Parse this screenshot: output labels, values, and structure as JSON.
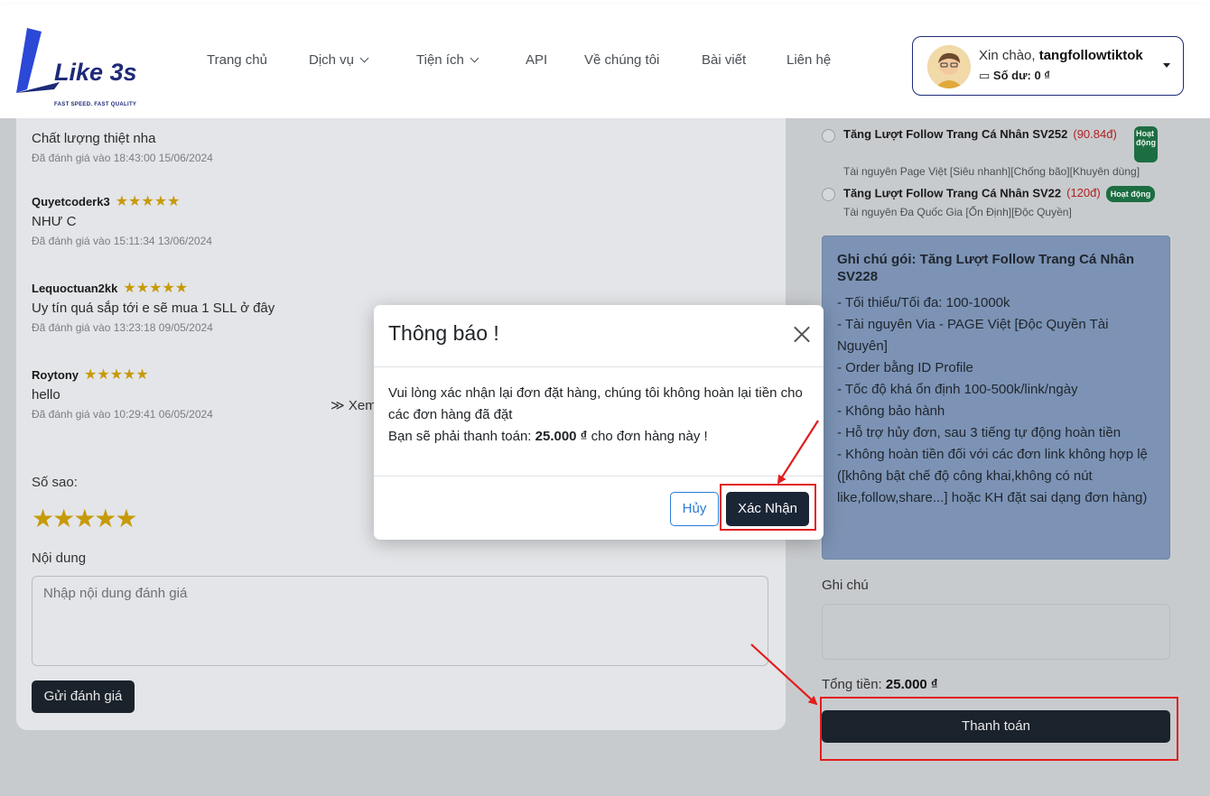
{
  "header": {
    "logo": {
      "brand": "Like 3s",
      "tagline": "FAST SPEED. FAST QUALITY"
    },
    "nav": [
      {
        "label": "Trang chủ"
      },
      {
        "label": "Dịch vụ"
      },
      {
        "label": "Tiện ích"
      },
      {
        "label": "API"
      },
      {
        "label": "Về chúng tôi"
      },
      {
        "label": "Bài viết"
      },
      {
        "label": "Liên hệ"
      }
    ],
    "user": {
      "greeting": "Xin chào,",
      "username": "tangfollowtiktok",
      "balance": "Số dư: 0 ₫"
    }
  },
  "reviews": [
    {
      "name": "",
      "text": "Chất lượng thiệt nha",
      "date": "Đã đánh giá vào 18:43:00 15/06/2024"
    },
    {
      "name": "Quyetcoderk3",
      "stars": "★★★★★",
      "text": "NHƯ C",
      "date": "Đã đánh giá vào 15:11:34 13/06/2024"
    },
    {
      "name": "Lequoctuan2kk",
      "stars": "★★★★★",
      "text": "Uy tín quá sắp tới e sẽ mua 1 SLL ở đây",
      "date": "Đã đánh giá vào 13:23:18 09/05/2024"
    },
    {
      "name": "Roytony",
      "stars": "★★★★★",
      "text": "hello",
      "date": "Đã đánh giá vào 10:29:41 06/05/2024"
    }
  ],
  "review_form": {
    "more": "Xem",
    "stars_label": "Số sao:",
    "stars": "★★★★★",
    "content_label": "Nội dung",
    "content_placeholder": "Nhập nội dung đánh giá",
    "submit": "Gửi đánh giá"
  },
  "services": [
    {
      "title": "Tăng Lượt Follow Trang Cá Nhân SV252",
      "price": "(90.84đ)",
      "status": "Hoạt động",
      "desc": "Tài nguyên Page Việt [Siêu nhanh][Chống bão][Khuyên dùng]"
    },
    {
      "title": "Tăng Lượt Follow Trang Cá Nhân SV22",
      "price": "(120đ)",
      "status": "Hoạt động",
      "desc": "Tài nguyên Đa Quốc Gia [Ổn Định][Độc Quyền]"
    }
  ],
  "package_note": {
    "title": "Ghi chú gói: Tăng Lượt Follow Trang Cá Nhân SV228",
    "lines": [
      "- Tối thiểu/Tối đa: 100-1000k",
      "- Tài nguyên Via - PAGE Việt [Độc Quyền Tài Nguyên]",
      "- Order bằng ID Profile",
      "- Tốc độ khá ổn định 100-500k/link/ngày",
      "- Không bảo hành",
      "- Hỗ trợ hủy đơn, sau 3 tiếng tự động hoàn tiền",
      "- Không hoàn tiền đối với các đơn link không hợp lệ ([không bật chế độ công khai,không có nút like,follow,share...] hoặc KH đặt sai dạng đơn hàng)"
    ]
  },
  "order": {
    "note_label": "Ghi chú",
    "total_label": "Tổng tiền:",
    "total_value": "25.000 ₫",
    "pay_button": "Thanh toán"
  },
  "modal": {
    "title": "Thông báo !",
    "message": "Vui lòng xác nhận lại đơn đặt hàng, chúng tôi không hoàn lại tiền cho các đơn hàng đã đặt",
    "pay_prefix": "Bạn sẽ phải thanh toán:",
    "pay_amount": "25.000 ₫",
    "pay_suffix": "cho đơn hàng này !",
    "cancel": "Hủy",
    "confirm": "Xác Nhận"
  },
  "colors": {
    "brand": "#1e2a78",
    "dark_button": "#1a222b",
    "annotation_red": "#e21d1d",
    "badge_green": "#1d6d42"
  }
}
